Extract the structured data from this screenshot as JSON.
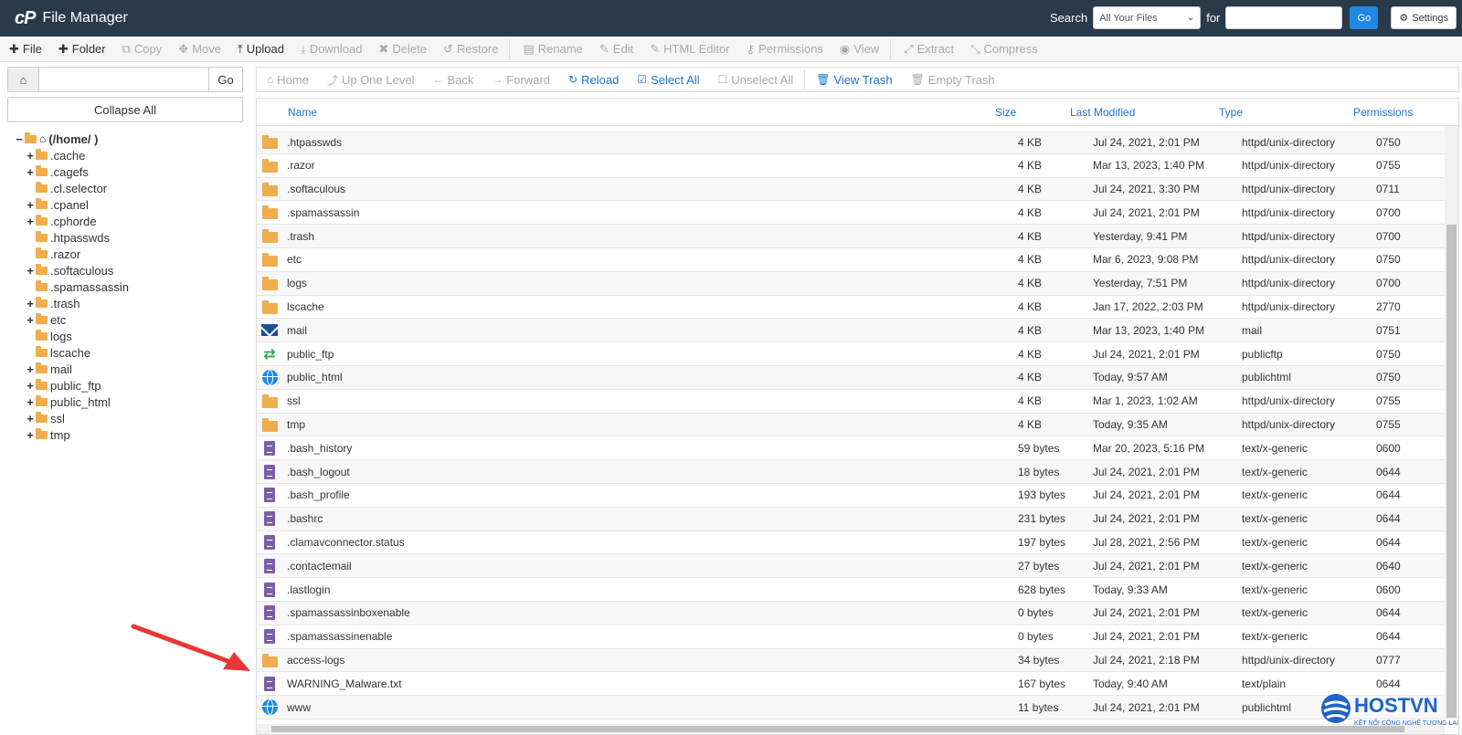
{
  "header": {
    "logo_mark": "cP",
    "app_title": "File Manager",
    "search_label": "Search",
    "search_scope_selected": "All Your Files",
    "for_label": "for",
    "go_label": "Go",
    "settings_label": "Settings"
  },
  "toolbar": {
    "items": [
      {
        "label": "File",
        "icon": "plus-icon",
        "enabled": true
      },
      {
        "label": "Folder",
        "icon": "plus-icon",
        "enabled": true
      },
      {
        "label": "Copy",
        "icon": "copy-icon",
        "enabled": false
      },
      {
        "label": "Move",
        "icon": "move-icon",
        "enabled": false
      },
      {
        "label": "Upload",
        "icon": "upload-icon",
        "enabled": true
      },
      {
        "label": "Download",
        "icon": "download-icon",
        "enabled": false
      },
      {
        "label": "Delete",
        "icon": "delete-icon",
        "enabled": false
      },
      {
        "label": "Restore",
        "icon": "restore-icon",
        "enabled": false
      },
      {
        "label": "Rename",
        "icon": "rename-icon",
        "enabled": false
      },
      {
        "label": "Edit",
        "icon": "edit-icon",
        "enabled": false
      },
      {
        "label": "HTML Editor",
        "icon": "html-editor-icon",
        "enabled": false
      },
      {
        "label": "Permissions",
        "icon": "key-icon",
        "enabled": false
      },
      {
        "label": "View",
        "icon": "eye-icon",
        "enabled": false
      },
      {
        "label": "Extract",
        "icon": "extract-icon",
        "enabled": false
      },
      {
        "label": "Compress",
        "icon": "compress-icon",
        "enabled": false
      }
    ]
  },
  "left": {
    "go_label": "Go",
    "collapse_all_label": "Collapse All",
    "tree": [
      {
        "label": "(/home/        )",
        "prefix": "−",
        "root": true
      },
      {
        "label": ".cache",
        "prefix": "+"
      },
      {
        "label": ".cagefs",
        "prefix": "+"
      },
      {
        "label": ".cl.selector",
        "prefix": ""
      },
      {
        "label": ".cpanel",
        "prefix": "+"
      },
      {
        "label": ".cphorde",
        "prefix": "+"
      },
      {
        "label": ".htpasswds",
        "prefix": ""
      },
      {
        "label": ".razor",
        "prefix": ""
      },
      {
        "label": ".softaculous",
        "prefix": "+"
      },
      {
        "label": ".spamassassin",
        "prefix": ""
      },
      {
        "label": ".trash",
        "prefix": "+"
      },
      {
        "label": "etc",
        "prefix": "+"
      },
      {
        "label": "logs",
        "prefix": ""
      },
      {
        "label": "lscache",
        "prefix": ""
      },
      {
        "label": "mail",
        "prefix": "+"
      },
      {
        "label": "public_ftp",
        "prefix": "+"
      },
      {
        "label": "public_html",
        "prefix": "+"
      },
      {
        "label": "ssl",
        "prefix": "+"
      },
      {
        "label": "tmp",
        "prefix": "+"
      }
    ]
  },
  "nav": {
    "items": [
      {
        "label": "Home",
        "icon": "home-icon",
        "style": "gray"
      },
      {
        "label": "Up One Level",
        "icon": "level-up-icon",
        "style": "gray"
      },
      {
        "label": "Back",
        "icon": "arrow-left-icon",
        "style": "gray"
      },
      {
        "label": "Forward",
        "icon": "arrow-right-icon",
        "style": "gray"
      },
      {
        "label": "Reload",
        "icon": "reload-icon",
        "style": "blue"
      },
      {
        "label": "Select All",
        "icon": "checkbox-checked-icon",
        "style": "blue"
      },
      {
        "label": "Unselect All",
        "icon": "checkbox-empty-icon",
        "style": "gray"
      },
      {
        "label": "View Trash",
        "icon": "trash-icon",
        "style": "blue"
      },
      {
        "label": "Empty Trash",
        "icon": "trash-icon",
        "style": "gray"
      }
    ]
  },
  "table": {
    "columns": [
      "Name",
      "Size",
      "Last Modified",
      "Type",
      "Permissions"
    ],
    "rows": [
      {
        "icon": "folder",
        "name": ".htpasswds",
        "size": "4 KB",
        "modified": "Jul 24, 2021, 2:01 PM",
        "type": "httpd/unix-directory",
        "perms": "0750"
      },
      {
        "icon": "folder",
        "name": ".razor",
        "size": "4 KB",
        "modified": "Mar 13, 2023, 1:40 PM",
        "type": "httpd/unix-directory",
        "perms": "0755"
      },
      {
        "icon": "folder",
        "name": ".softaculous",
        "size": "4 KB",
        "modified": "Jul 24, 2021, 3:30 PM",
        "type": "httpd/unix-directory",
        "perms": "0711"
      },
      {
        "icon": "folder",
        "name": ".spamassassin",
        "size": "4 KB",
        "modified": "Jul 24, 2021, 2:01 PM",
        "type": "httpd/unix-directory",
        "perms": "0700"
      },
      {
        "icon": "folder",
        "name": ".trash",
        "size": "4 KB",
        "modified": "Yesterday, 9:41 PM",
        "type": "httpd/unix-directory",
        "perms": "0700"
      },
      {
        "icon": "folder",
        "name": "etc",
        "size": "4 KB",
        "modified": "Mar 6, 2023, 9:08 PM",
        "type": "httpd/unix-directory",
        "perms": "0750"
      },
      {
        "icon": "folder",
        "name": "logs",
        "size": "4 KB",
        "modified": "Yesterday, 7:51 PM",
        "type": "httpd/unix-directory",
        "perms": "0700"
      },
      {
        "icon": "folder",
        "name": "lscache",
        "size": "4 KB",
        "modified": "Jan 17, 2022, 2:03 PM",
        "type": "httpd/unix-directory",
        "perms": "2770"
      },
      {
        "icon": "mail",
        "name": "mail",
        "size": "4 KB",
        "modified": "Mar 13, 2023, 1:40 PM",
        "type": "mail",
        "perms": "0751"
      },
      {
        "icon": "ftp",
        "name": "public_ftp",
        "size": "4 KB",
        "modified": "Jul 24, 2021, 2:01 PM",
        "type": "publicftp",
        "perms": "0750"
      },
      {
        "icon": "globe",
        "name": "public_html",
        "size": "4 KB",
        "modified": "Today, 9:57 AM",
        "type": "publichtml",
        "perms": "0750"
      },
      {
        "icon": "folder",
        "name": "ssl",
        "size": "4 KB",
        "modified": "Mar 1, 2023, 1:02 AM",
        "type": "httpd/unix-directory",
        "perms": "0755"
      },
      {
        "icon": "folder",
        "name": "tmp",
        "size": "4 KB",
        "modified": "Today, 9:35 AM",
        "type": "httpd/unix-directory",
        "perms": "0755"
      },
      {
        "icon": "file",
        "name": ".bash_history",
        "size": "59 bytes",
        "modified": "Mar 20, 2023, 5:16 PM",
        "type": "text/x-generic",
        "perms": "0600"
      },
      {
        "icon": "file",
        "name": ".bash_logout",
        "size": "18 bytes",
        "modified": "Jul 24, 2021, 2:01 PM",
        "type": "text/x-generic",
        "perms": "0644"
      },
      {
        "icon": "file",
        "name": ".bash_profile",
        "size": "193 bytes",
        "modified": "Jul 24, 2021, 2:01 PM",
        "type": "text/x-generic",
        "perms": "0644"
      },
      {
        "icon": "file",
        "name": ".bashrc",
        "size": "231 bytes",
        "modified": "Jul 24, 2021, 2:01 PM",
        "type": "text/x-generic",
        "perms": "0644"
      },
      {
        "icon": "file",
        "name": ".clamavconnector.status",
        "size": "197 bytes",
        "modified": "Jul 28, 2021, 2:56 PM",
        "type": "text/x-generic",
        "perms": "0644"
      },
      {
        "icon": "file",
        "name": ".contactemail",
        "size": "27 bytes",
        "modified": "Jul 24, 2021, 2:01 PM",
        "type": "text/x-generic",
        "perms": "0640"
      },
      {
        "icon": "file",
        "name": ".lastlogin",
        "size": "628 bytes",
        "modified": "Today, 9:33 AM",
        "type": "text/x-generic",
        "perms": "0600"
      },
      {
        "icon": "file",
        "name": ".spamassassinboxenable",
        "size": "0 bytes",
        "modified": "Jul 24, 2021, 2:01 PM",
        "type": "text/x-generic",
        "perms": "0644"
      },
      {
        "icon": "file",
        "name": ".spamassassinenable",
        "size": "0 bytes",
        "modified": "Jul 24, 2021, 2:01 PM",
        "type": "text/x-generic",
        "perms": "0644"
      },
      {
        "icon": "folder-link",
        "name": "access-logs",
        "size": "34 bytes",
        "modified": "Jul 24, 2021, 2:18 PM",
        "type": "httpd/unix-directory",
        "perms": "0777"
      },
      {
        "icon": "file",
        "name": "WARNING_Malware.txt",
        "size": "167 bytes",
        "modified": "Today, 9:40 AM",
        "type": "text/plain",
        "perms": "0644"
      },
      {
        "icon": "globe-link",
        "name": "www",
        "size": "11 bytes",
        "modified": "Jul 24, 2021, 2:01 PM",
        "type": "publichtml",
        "perms": ""
      }
    ]
  },
  "watermark": {
    "brand": "HOSTVN",
    "tagline": "KẾT NỐI CÔNG NGHỆ TƯƠNG LAI"
  },
  "colors": {
    "header_bg": "#293a4a",
    "accent": "#1976d2",
    "folder": "#f0ad4e",
    "file": "#7b5fa6",
    "arrow": "#e53935"
  }
}
